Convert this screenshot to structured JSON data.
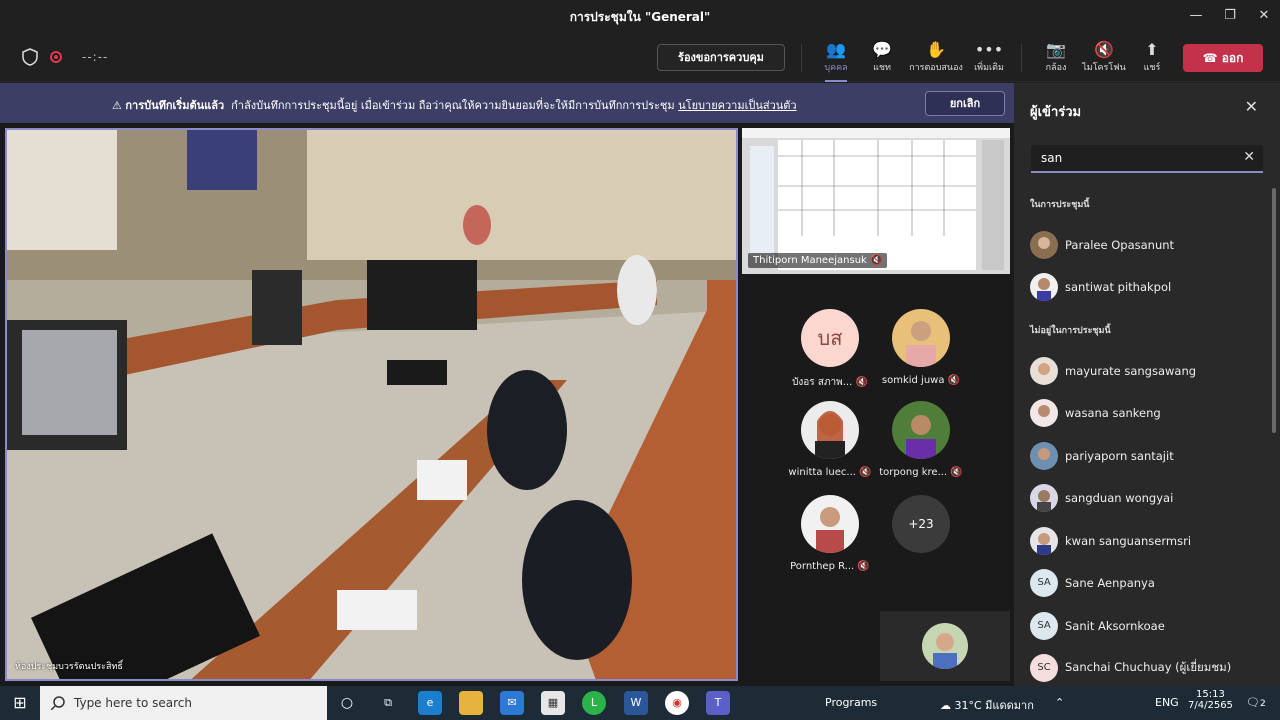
{
  "window": {
    "title": "การประชุมใน \"General\""
  },
  "toolbar": {
    "timer": "--:--",
    "request_control": "ร้องขอการควบคุม",
    "people": "บุคคล",
    "chat": "แชท",
    "reactions": "การตอบสนอง",
    "more": "เพิ่มเติม",
    "camera": "กล้อง",
    "mic": "ไมโครโฟน",
    "share": "แชร์",
    "leave": "ออก"
  },
  "banner": {
    "bold": "การบันทึกเริ่มต้นแล้ว",
    "text": "กำลังบันทึกการประชุมนี้อยู่ เมื่อเข้าร่วม ถือว่าคุณให้ความยินยอมที่จะให้มีการบันทึกการประชุม",
    "link": "นโยบายความเป็นส่วนตัว",
    "cancel": "ยกเลิก"
  },
  "stage": {
    "room_label": "ห้องประชุมบวรรัตนประสิทธิ์",
    "share_label": "Thitiporn Maneejansuk",
    "tiles": [
      {
        "name": "บังอร สภาพ...",
        "initials": "บส"
      },
      {
        "name": "somkid juwa"
      },
      {
        "name": "winitta luec..."
      },
      {
        "name": "torpong kre..."
      },
      {
        "name": "Pornthep R..."
      },
      {
        "name": "+23"
      }
    ]
  },
  "panel": {
    "title": "ผู้เข้าร่วม",
    "search_value": "san",
    "section_in": "ในการประชุมนี้",
    "section_out": "ไม่อยู่ในการประชุมนี้",
    "in_meeting": [
      {
        "name": "Paralee Opasanunt"
      },
      {
        "name": "santiwat pithakpol"
      }
    ],
    "not_in_meeting": [
      {
        "name": "mayurate sangsawang"
      },
      {
        "name": "wasana sankeng"
      },
      {
        "name": "pariyaporn santajit"
      },
      {
        "name": "sangduan wongyai"
      },
      {
        "name": "kwan sanguansermsri"
      },
      {
        "name": "Sane Aenpanya",
        "initials": "SA"
      },
      {
        "name": "Sanit Aksornkoae",
        "initials": "SA"
      },
      {
        "name": "Sanchai Chuchuay (ผู้เยี่ยมชม)",
        "initials": "SC"
      }
    ]
  },
  "taskbar": {
    "search_placeholder": "Type here to search",
    "programs": "Programs",
    "weather": "31°C มีแดดมาก",
    "lang": "ENG",
    "time": "15:13",
    "date": "7/4/2565",
    "notifications": "2"
  },
  "colors": {
    "accent": "#8b8cc7",
    "leave": "#c4314b",
    "banner": "#3d3e66"
  }
}
